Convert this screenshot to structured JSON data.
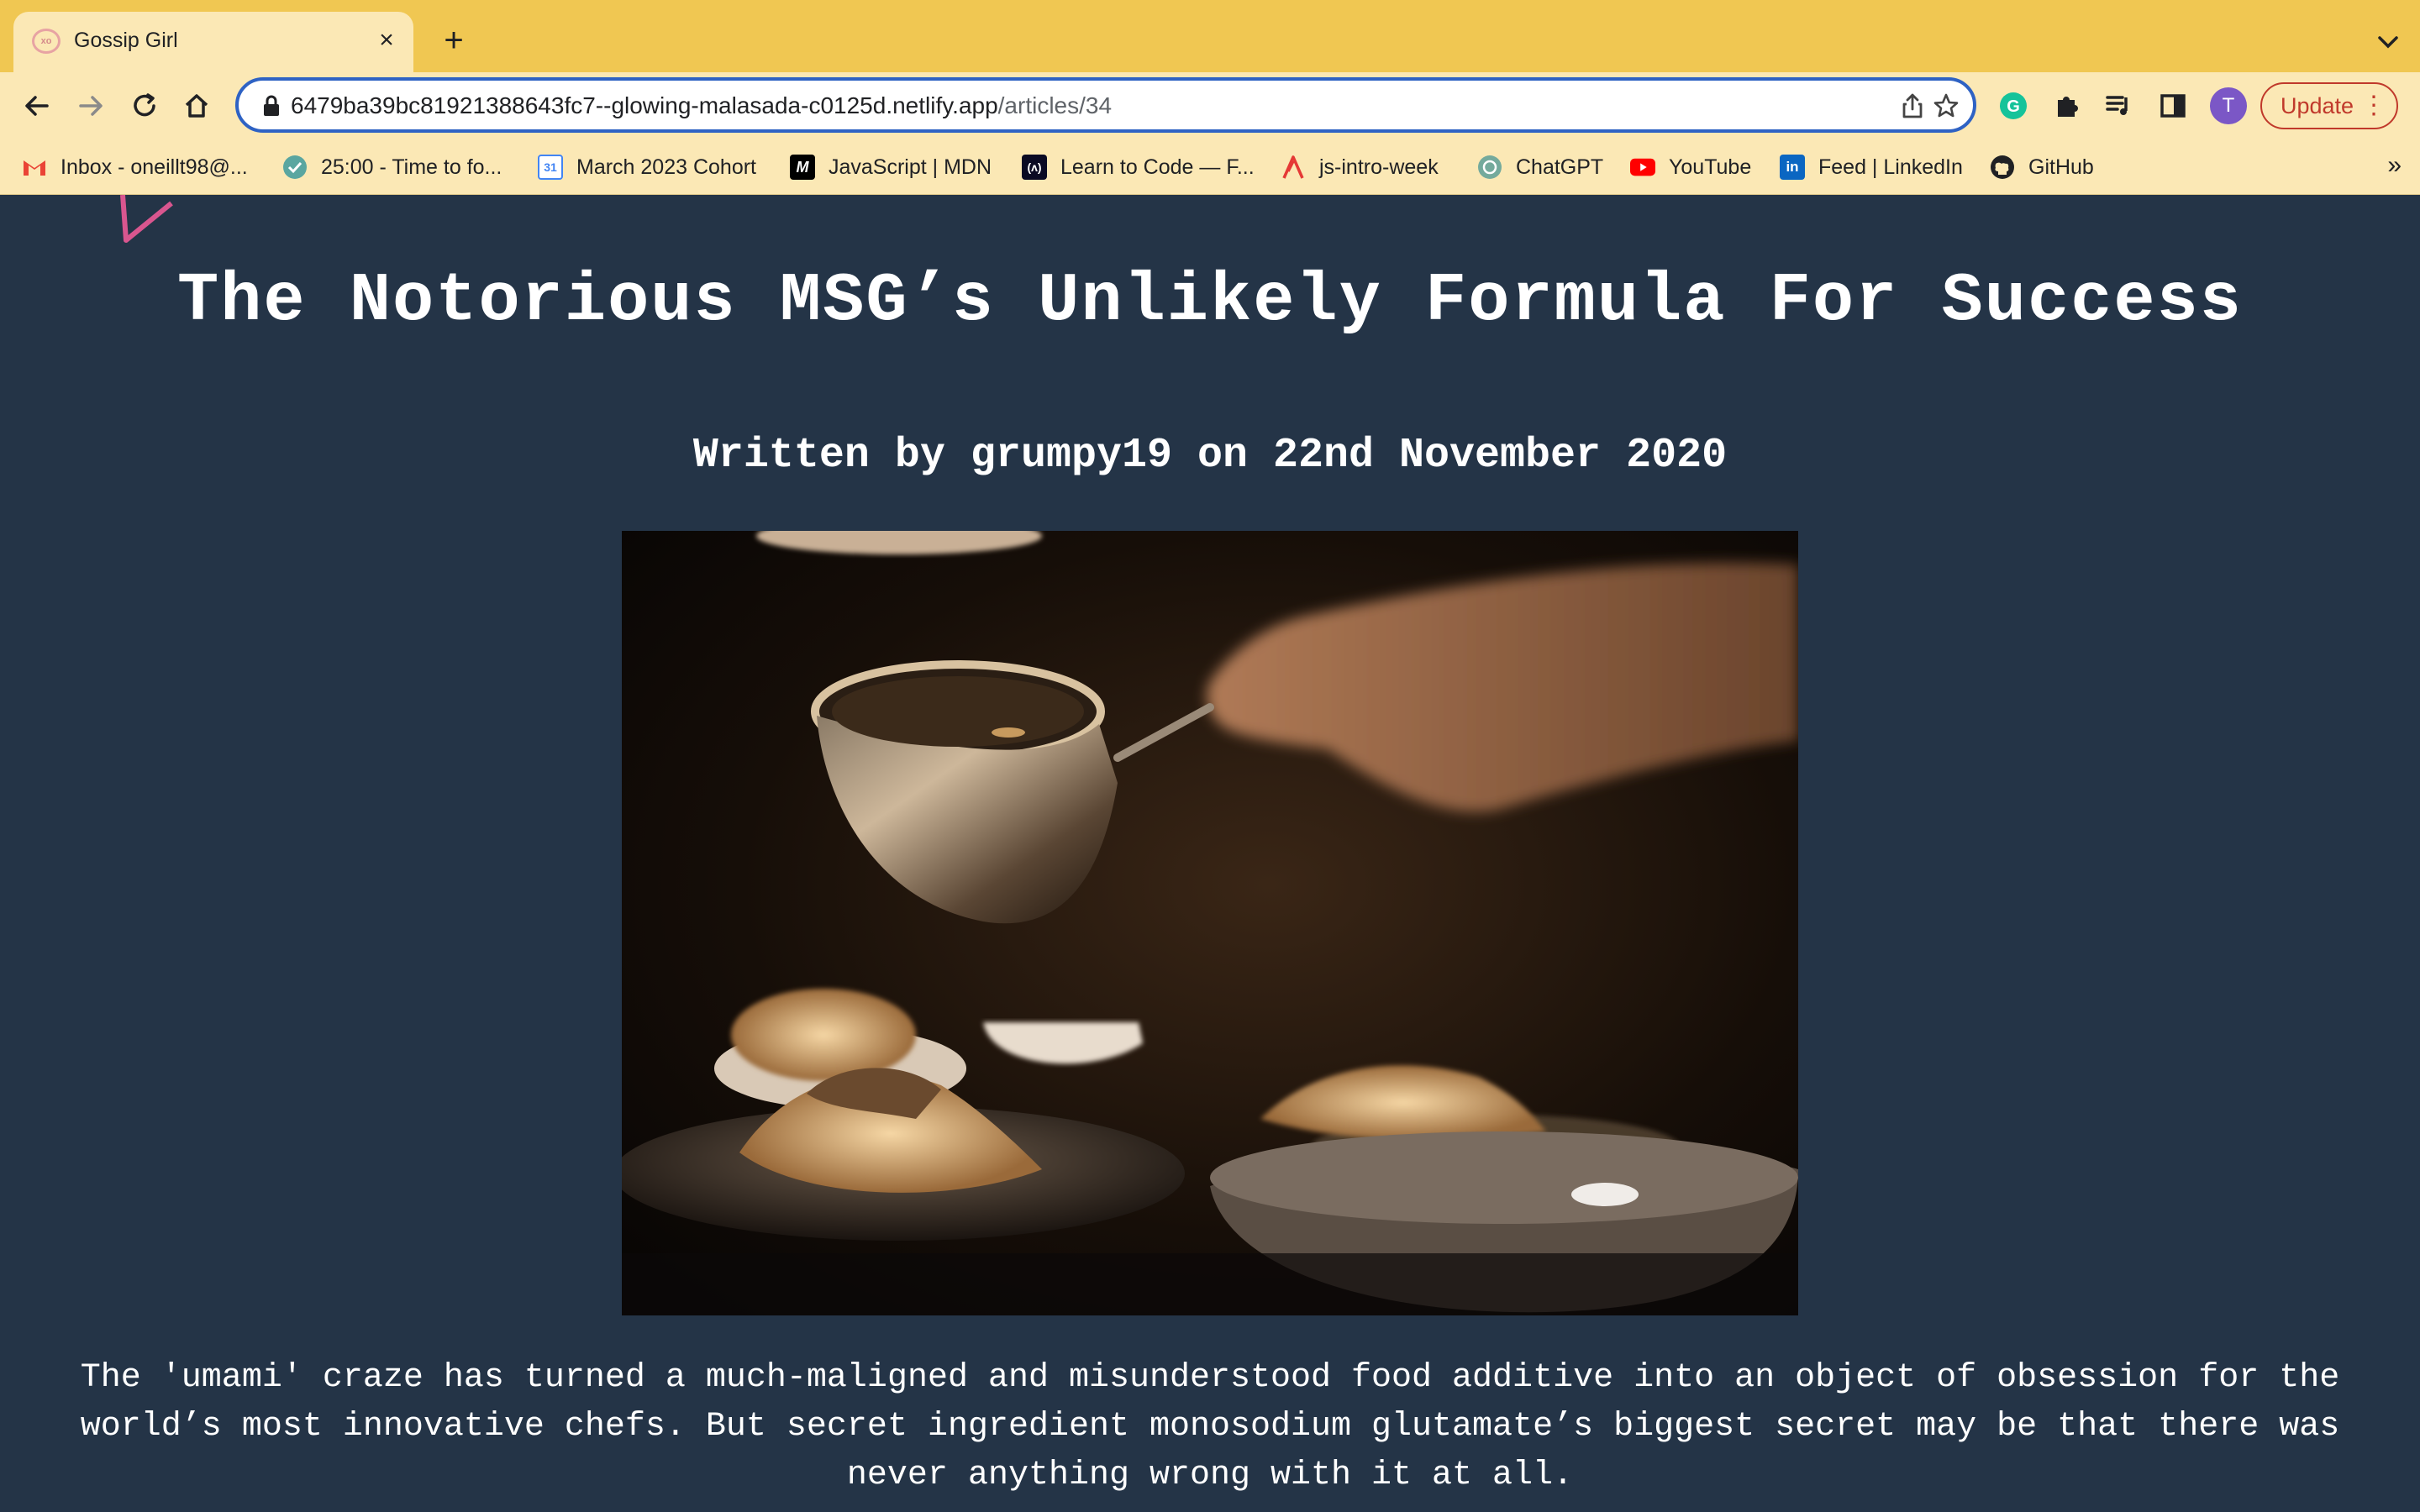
{
  "browser": {
    "tab": {
      "title": "Gossip Girl",
      "favicon": "xoxo-icon"
    },
    "url": {
      "host": "6479ba39bc81921388643fc7--glowing-malasada-c0125d.netlify.app",
      "path": "/articles/34"
    },
    "profile_initial": "T",
    "update_label": "Update",
    "bookmarks": [
      {
        "label": "Inbox - oneillt98@...",
        "icon": "gmail-icon"
      },
      {
        "label": "25:00 - Time to fo...",
        "icon": "check-circle-icon"
      },
      {
        "label": "March 2023 Cohort",
        "icon": "calendar-icon"
      },
      {
        "label": "JavaScript | MDN",
        "icon": "mdn-icon"
      },
      {
        "label": "Learn to Code — F...",
        "icon": "freecodecamp-icon"
      },
      {
        "label": "js-intro-week",
        "icon": "a-logo-icon"
      },
      {
        "label": "ChatGPT",
        "icon": "chatgpt-icon"
      },
      {
        "label": "YouTube",
        "icon": "youtube-icon"
      },
      {
        "label": "Feed | LinkedIn",
        "icon": "linkedin-icon"
      },
      {
        "label": "GitHub",
        "icon": "github-icon"
      }
    ],
    "bookmarks_overflow": "»"
  },
  "article": {
    "title": "The Notorious MSG’s Unlikely Formula For Success",
    "byline": "Written by grumpy19 on 22nd November 2020",
    "body": "The 'umami' craze has turned a much-maligned and misunderstood food additive into an object of obsession for the world’s most innovative chefs. But secret ingredient monosodium glutamate’s biggest secret may be that there was never anything wrong with it at all."
  },
  "colors": {
    "page_bg": "#243447",
    "tabstrip": "#f0c752",
    "toolbar": "#fbe8b5",
    "omnibox_border": "#2e62c4",
    "accent_pink": "#d9568f"
  }
}
